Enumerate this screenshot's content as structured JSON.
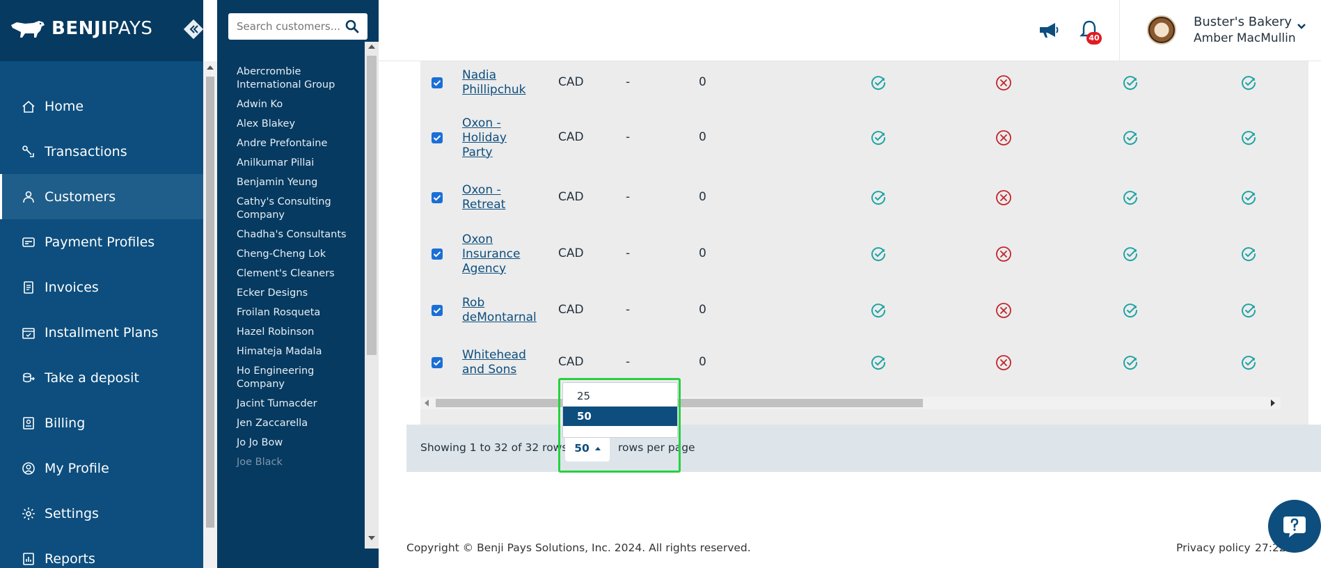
{
  "brand": {
    "name_bold": "BENJI",
    "name_thin": "PAYS"
  },
  "nav": {
    "items": [
      {
        "label": "Home",
        "icon": "home-icon"
      },
      {
        "label": "Transactions",
        "icon": "transactions-icon"
      },
      {
        "label": "Customers",
        "icon": "customers-icon",
        "active": true
      },
      {
        "label": "Payment Profiles",
        "icon": "payment-profiles-icon"
      },
      {
        "label": "Invoices",
        "icon": "invoices-icon"
      },
      {
        "label": "Installment Plans",
        "icon": "installment-plans-icon"
      },
      {
        "label": "Take a deposit",
        "icon": "deposit-icon"
      },
      {
        "label": "Billing",
        "icon": "billing-icon"
      },
      {
        "label": "My Profile",
        "icon": "profile-icon"
      },
      {
        "label": "Settings",
        "icon": "settings-icon"
      },
      {
        "label": "Reports",
        "icon": "reports-icon"
      }
    ]
  },
  "customer_panel": {
    "search_placeholder": "Search customers...",
    "customers": [
      "Abercrombie International Group",
      "Adwin Ko",
      "Alex Blakey",
      "Andre Prefontaine",
      "Anilkumar Pillai",
      "Benjamin Yeung",
      "Cathy's Consulting Company",
      "Chadha's Consultants",
      "Cheng-Cheng Lok",
      "Clement's Cleaners",
      "Ecker Designs",
      "Froilan Rosqueta",
      "Hazel Robinson",
      "Himateja Madala",
      "Ho Engineering Company",
      "Jacint Tumacder",
      "Jen Zaccarella",
      "Jo Jo Bow",
      "Joe Black"
    ]
  },
  "header": {
    "notification_count": "40",
    "business_name": "Buster's Bakery",
    "user_name": "Amber MacMullin"
  },
  "table": {
    "rows": [
      {
        "name_lines": [
          "Nadia",
          "Phillipchuk"
        ],
        "currency": "CAD",
        "col3": "-",
        "col4": "0",
        "checked": true,
        "statuses": [
          "check",
          "x",
          "check",
          "check"
        ]
      },
      {
        "name_lines": [
          "Oxon -",
          "Holiday",
          "Party"
        ],
        "currency": "CAD",
        "col3": "-",
        "col4": "0",
        "checked": true,
        "statuses": [
          "check",
          "x",
          "check",
          "check"
        ]
      },
      {
        "name_lines": [
          "Oxon -",
          "Retreat"
        ],
        "currency": "CAD",
        "col3": "-",
        "col4": "0",
        "checked": true,
        "statuses": [
          "check",
          "x",
          "check",
          "check"
        ]
      },
      {
        "name_lines": [
          "Oxon",
          "Insurance",
          "Agency"
        ],
        "currency": "CAD",
        "col3": "-",
        "col4": "0",
        "checked": true,
        "statuses": [
          "check",
          "x",
          "check",
          "check"
        ]
      },
      {
        "name_lines": [
          "Rob",
          "deMontarnal"
        ],
        "currency": "CAD",
        "col3": "-",
        "col4": "0",
        "checked": true,
        "statuses": [
          "check",
          "x",
          "check",
          "check"
        ]
      },
      {
        "name_lines": [
          "Whitehead",
          "and Sons"
        ],
        "currency": "CAD",
        "col3": "-",
        "col4": "0",
        "checked": true,
        "statuses": [
          "check",
          "x",
          "check",
          "check"
        ]
      }
    ]
  },
  "pager": {
    "showing": "Showing 1 to 32 of 32 rows",
    "page_size": "50",
    "rows_per_page": "rows per page",
    "options": [
      "25",
      "50"
    ],
    "selected_option": "50"
  },
  "footer": {
    "copyright": "Copyright © Benji Pays Solutions, Inc. 2024. All rights reserved.",
    "privacy": "Privacy policy",
    "clock": "27:22"
  },
  "colors": {
    "nav_bg": "#0d4e7e",
    "panel_bg": "#063a60",
    "check": "#1fa3a3",
    "cross": "#c0262d",
    "highlight": "#25d240"
  }
}
